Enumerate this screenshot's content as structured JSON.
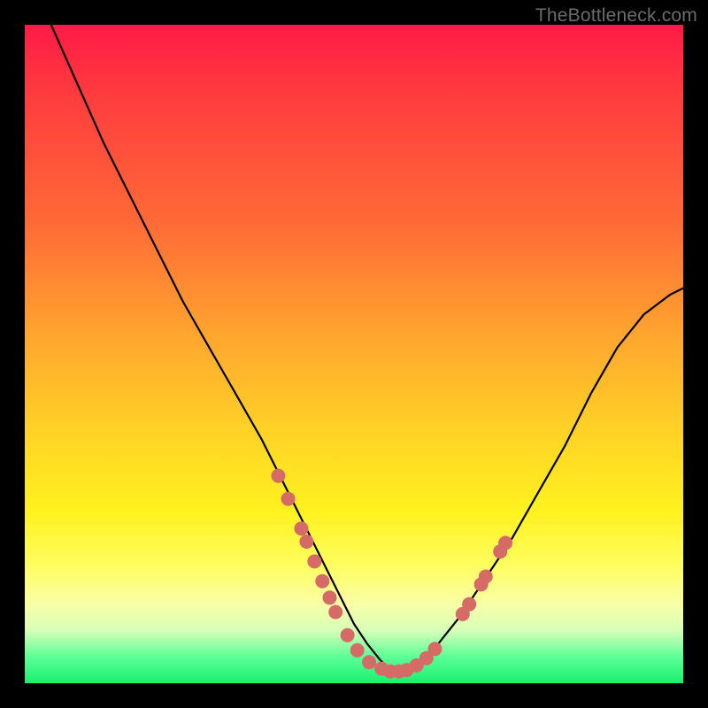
{
  "watermark": "TheBottleneck.com",
  "colors": {
    "frame": "#000000",
    "curve": "#000000",
    "dot_fill": "#d66a66",
    "dot_stroke": "#c85a55",
    "gradient_stops": [
      "#ff1a46",
      "#ff6a36",
      "#ffd326",
      "#fff21f",
      "#f8ffa6",
      "#19f06f"
    ]
  },
  "chart_data": {
    "type": "line",
    "title": "",
    "xlabel": "",
    "ylabel": "",
    "xlim": [
      0,
      100
    ],
    "ylim": [
      0,
      100
    ],
    "series": [
      {
        "name": "bottleneck-curve",
        "x": [
          4,
          8,
          12,
          16,
          20,
          24,
          28,
          32,
          36,
          38,
          40,
          42,
          44,
          46,
          48,
          50,
          52,
          54,
          55,
          56,
          58,
          60,
          62,
          66,
          70,
          74,
          78,
          82,
          86,
          90,
          94,
          98,
          100
        ],
        "y": [
          100,
          91,
          82,
          74,
          66,
          58,
          51,
          44,
          37,
          33,
          29,
          25,
          21,
          17,
          13,
          9,
          6,
          3.5,
          2.5,
          2,
          2,
          3,
          5,
          10,
          16,
          22,
          29,
          36,
          44,
          51,
          56,
          59,
          60
        ]
      }
    ],
    "marker_clusters": [
      {
        "name": "left-arm-dots",
        "points": [
          [
            38.5,
            31.5
          ],
          [
            40.0,
            28.0
          ],
          [
            42.0,
            23.5
          ],
          [
            42.8,
            21.5
          ],
          [
            44.0,
            18.5
          ],
          [
            45.2,
            15.5
          ],
          [
            46.3,
            13.0
          ],
          [
            47.2,
            10.8
          ]
        ]
      },
      {
        "name": "valley-dots",
        "points": [
          [
            49.0,
            7.3
          ],
          [
            50.5,
            5.0
          ],
          [
            52.3,
            3.2
          ],
          [
            54.2,
            2.2
          ],
          [
            55.5,
            1.8
          ],
          [
            56.8,
            1.8
          ],
          [
            58.0,
            2.0
          ],
          [
            59.5,
            2.7
          ],
          [
            61.0,
            3.8
          ],
          [
            62.3,
            5.2
          ]
        ]
      },
      {
        "name": "right-arm-dots",
        "points": [
          [
            66.5,
            10.5
          ],
          [
            67.5,
            12.0
          ],
          [
            69.3,
            15.0
          ],
          [
            70.0,
            16.2
          ],
          [
            72.2,
            20.0
          ],
          [
            73.0,
            21.3
          ]
        ]
      }
    ]
  }
}
